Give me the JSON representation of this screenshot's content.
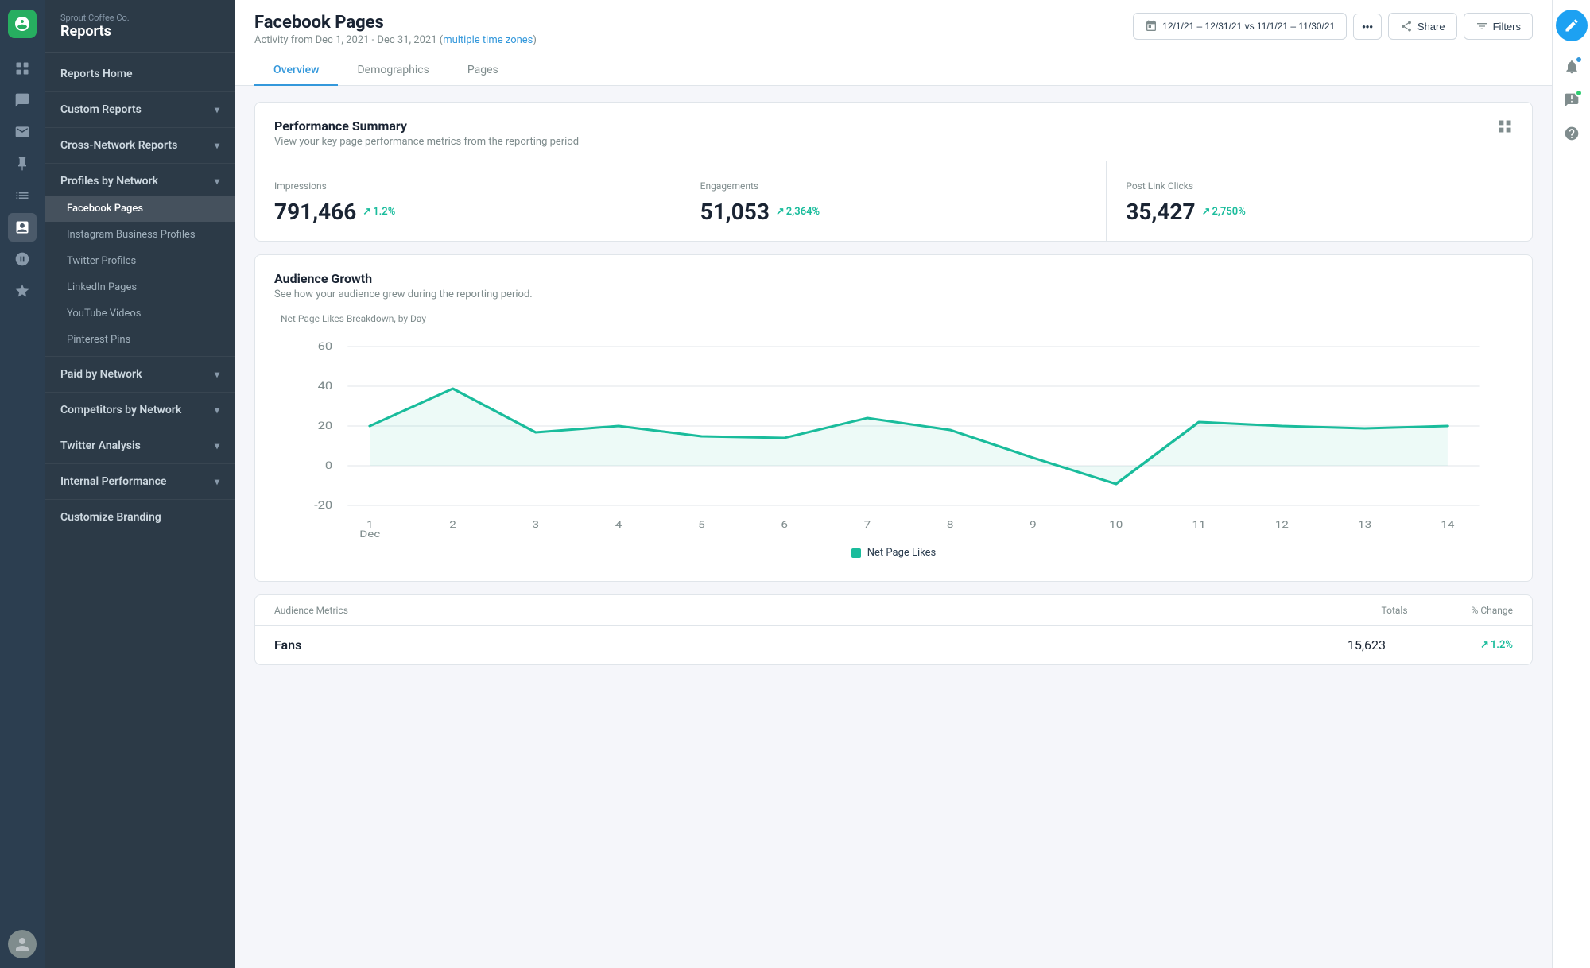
{
  "brand": {
    "company": "Sprout Coffee Co.",
    "section": "Reports"
  },
  "sidebar": {
    "home_label": "Reports Home",
    "sections": [
      {
        "id": "custom-reports",
        "label": "Custom Reports",
        "expanded": false
      },
      {
        "id": "cross-network",
        "label": "Cross-Network Reports",
        "expanded": false
      },
      {
        "id": "profiles-by-network",
        "label": "Profiles by Network",
        "expanded": true,
        "items": [
          {
            "id": "facebook-pages",
            "label": "Facebook Pages",
            "active": true
          },
          {
            "id": "instagram-business",
            "label": "Instagram Business Profiles",
            "active": false
          },
          {
            "id": "twitter-profiles",
            "label": "Twitter Profiles",
            "active": false
          },
          {
            "id": "linkedin-pages",
            "label": "LinkedIn Pages",
            "active": false
          },
          {
            "id": "youtube-videos",
            "label": "YouTube Videos",
            "active": false
          },
          {
            "id": "pinterest-pins",
            "label": "Pinterest Pins",
            "active": false
          }
        ]
      },
      {
        "id": "paid-by-network",
        "label": "Paid by Network",
        "expanded": false
      },
      {
        "id": "competitors-by-network",
        "label": "Competitors by Network",
        "expanded": false
      },
      {
        "id": "twitter-analysis",
        "label": "Twitter Analysis",
        "expanded": false
      },
      {
        "id": "internal-performance",
        "label": "Internal Performance",
        "expanded": false
      }
    ],
    "customize_branding": "Customize Branding"
  },
  "page": {
    "title": "Facebook Pages",
    "subtitle": "Activity from Dec 1, 2021 - Dec 31, 2021",
    "timezone_note": "multiple time zones"
  },
  "header_actions": {
    "date_range": "12/1/21 – 12/31/21 vs 11/1/21 – 11/30/21",
    "share_label": "Share",
    "filters_label": "Filters"
  },
  "tabs": [
    {
      "id": "overview",
      "label": "Overview",
      "active": true
    },
    {
      "id": "demographics",
      "label": "Demographics",
      "active": false
    },
    {
      "id": "pages",
      "label": "Pages",
      "active": false
    }
  ],
  "performance_summary": {
    "title": "Performance Summary",
    "subtitle": "View your key page performance metrics from the reporting period",
    "metrics": [
      {
        "label": "Impressions",
        "value": "791,466",
        "change": "1.2%"
      },
      {
        "label": "Engagements",
        "value": "51,053",
        "change": "2,364%"
      },
      {
        "label": "Post Link Clicks",
        "value": "35,427",
        "change": "2,750%"
      }
    ]
  },
  "audience_growth": {
    "title": "Audience Growth",
    "subtitle": "See how your audience grew during the reporting period.",
    "chart_label": "Net Page Likes Breakdown, by Day",
    "y_axis": [
      "60",
      "40",
      "20",
      "0",
      "-20"
    ],
    "x_axis": [
      "1\nDec",
      "2",
      "3",
      "4",
      "5",
      "6",
      "7",
      "8",
      "9",
      "10",
      "11",
      "12",
      "13",
      "14"
    ],
    "legend_label": "Net Page Likes"
  },
  "audience_metrics": {
    "title": "Audience Metrics",
    "col_totals": "Totals",
    "col_change": "% Change",
    "rows": [
      {
        "label": "Fans",
        "value": "15,623",
        "change": "1.2%"
      }
    ]
  }
}
